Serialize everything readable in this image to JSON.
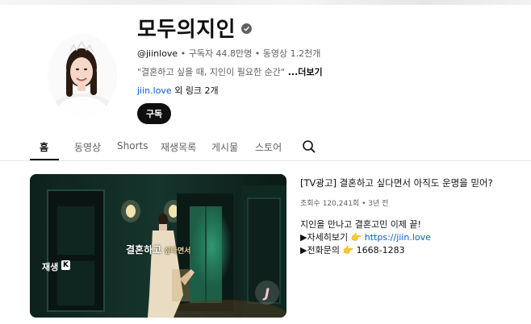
{
  "channel": {
    "title": "모두의지인",
    "handle": "@jiinlove",
    "sep": " • ",
    "subscribers": "구독자 44.8만명",
    "video_count": "동영상 1.2천개",
    "description": "\"결혼하고 싶을 때, 지인이 필요한 순간\"",
    "more_label": " ...더보기",
    "link_text": "jiin.love",
    "link_suffix": " 외 링크 2개",
    "subscribe_label": "구독"
  },
  "tabs": [
    {
      "label": "홈",
      "active": true
    },
    {
      "label": "동영상"
    },
    {
      "label": "Shorts"
    },
    {
      "label": "재생목록"
    },
    {
      "label": "게시물"
    },
    {
      "label": "스토어"
    }
  ],
  "video": {
    "play_label": "재생",
    "play_key": "K",
    "caption_main": "결혼하고",
    "caption_sub": " 싶다면서",
    "title": "[TV광고] 결혼하고 싶다면서 아직도 운명을 믿어?",
    "views": "조회수 120,241회",
    "age": "3년 전",
    "desc_line1": "지인을 만나고 결혼고민 이제 끝!",
    "desc_line2_prefix": "▶자세히보기 ",
    "desc_line2_link": "https://jiin.love",
    "desc_line3_prefix": "▶전화문의 ",
    "desc_line3_phone": "1668-1283",
    "pointer_emoji": "👉"
  },
  "colors": {
    "link": "#065fd4",
    "text": "#0f0f0f",
    "secondary": "#606060",
    "subscribe_bg": "#0f0f0f"
  },
  "icons": {
    "verified": "checkmark-badge-icon",
    "search": "search-icon"
  }
}
